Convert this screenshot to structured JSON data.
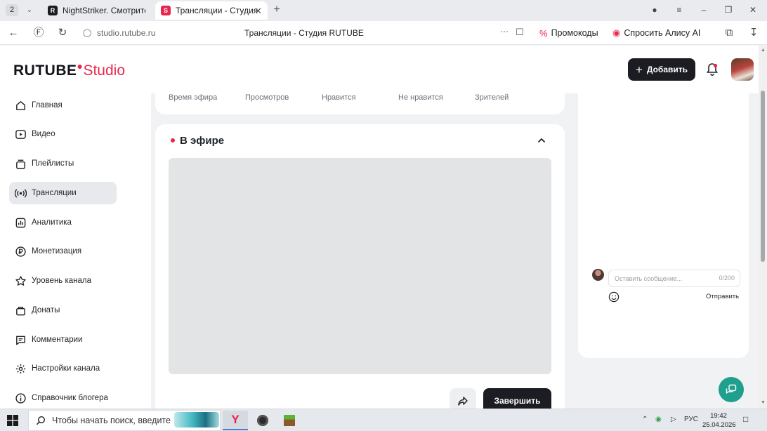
{
  "browser": {
    "tab_count": "2",
    "tabs": [
      {
        "title": "NightStriker. Смотрите ви"
      },
      {
        "title": "Трансляции - Студия R"
      }
    ],
    "url": "studio.rutube.ru",
    "page_title": "Трансляции - Студия RUTUBE",
    "promo_label": "Промокоды",
    "alice_label": "Спросить Алису AI"
  },
  "header": {
    "logo_text": "RUTUBE",
    "logo_studio": "Studio",
    "add_label": "Добавить"
  },
  "sidebar": {
    "items": [
      {
        "label": "Главная",
        "icon": "home-icon"
      },
      {
        "label": "Видео",
        "icon": "video-icon"
      },
      {
        "label": "Плейлисты",
        "icon": "playlist-icon"
      },
      {
        "label": "Трансляции",
        "icon": "broadcast-icon",
        "active": true
      },
      {
        "label": "Аналитика",
        "icon": "analytics-icon"
      },
      {
        "label": "Монетизация",
        "icon": "monetization-icon"
      },
      {
        "label": "Уровень канала",
        "icon": "star-icon"
      },
      {
        "label": "Донаты",
        "icon": "donate-icon"
      },
      {
        "label": "Комментарии",
        "icon": "comments-icon"
      },
      {
        "label": "Настройки канала",
        "icon": "gear-icon"
      },
      {
        "label": "Справочник блогера",
        "icon": "info-icon"
      }
    ]
  },
  "stats": {
    "labels": [
      "Время эфира",
      "Просмотров",
      "Нравится",
      "Не нравится",
      "Зрителей"
    ]
  },
  "live": {
    "title": "В эфире",
    "finish_label": "Завершить"
  },
  "chat": {
    "placeholder": "Оставить сообщение...",
    "counter": "0/200",
    "send_label": "Отправить"
  },
  "taskbar": {
    "search_placeholder": "Чтобы начать поиск, введите",
    "lang": "РУС",
    "time": "19:42",
    "date": "25.04.2026"
  },
  "colors": {
    "brand_red": "#e8264d",
    "dark_button": "#1b1d22",
    "help_fab": "#1f9f8e"
  }
}
